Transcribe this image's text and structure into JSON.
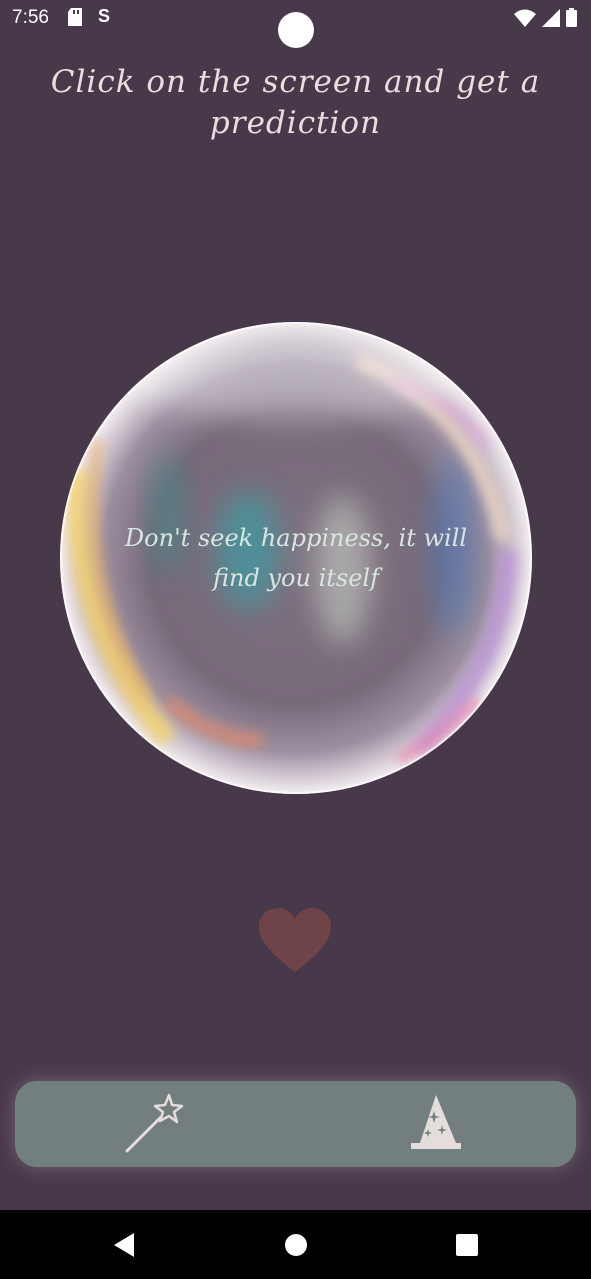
{
  "status_bar": {
    "time": "7:56",
    "icons": [
      "sd-card-icon",
      "s-app-icon",
      "wifi-icon",
      "signal-icon",
      "battery-icon"
    ]
  },
  "header": {
    "title": "Click on the screen and get a prediction"
  },
  "orb": {
    "prediction": "Don't seek happiness, it will find you itself"
  },
  "heart": {
    "icon": "heart-icon",
    "color": "#6e4448"
  },
  "bottom_nav": {
    "items": [
      {
        "icon": "magic-wand-icon"
      },
      {
        "icon": "wizard-hat-icon"
      }
    ],
    "background": "#737f7f"
  },
  "system_nav": {
    "buttons": [
      "back-icon",
      "home-icon",
      "recents-icon"
    ]
  },
  "colors": {
    "background": "#48394a",
    "title_text": "#e8dede",
    "prediction_text": "#d9e6e0"
  }
}
